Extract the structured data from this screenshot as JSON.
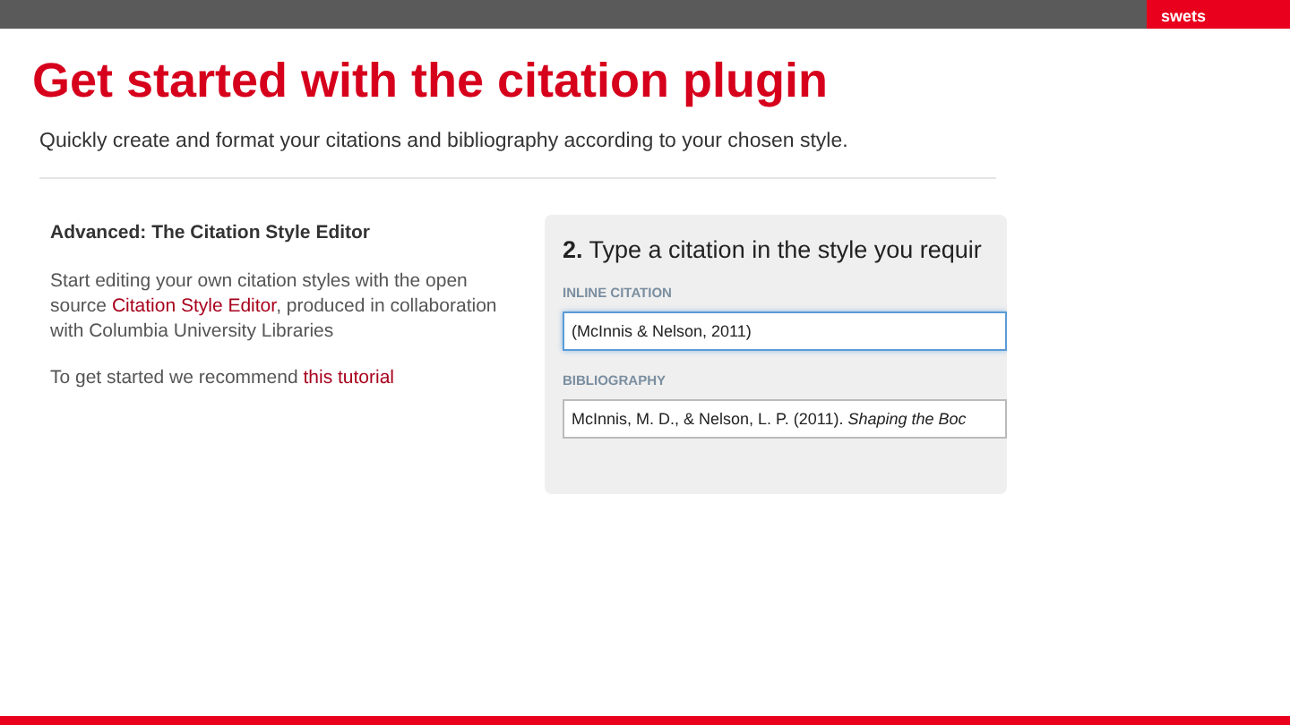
{
  "top_bar": {
    "brand": "swets"
  },
  "title": "Get started with the citation plugin",
  "subtitle": "Quickly create and format your citations and bibliography according to your chosen style.",
  "advanced": {
    "heading": "Advanced: The Citation Style Editor",
    "paragraphs": [
      {
        "before": "Start editing your own citation styles with the open source ",
        "link": "Citation Style Editor",
        "after": ", produced in collaboration with Columbia University Libraries"
      },
      {
        "before": "To get started we recommend ",
        "link": "this tutorial"
      }
    ]
  },
  "panel": {
    "heading": "**2.** Type a citation in the style you requir",
    "fields": [
      {
        "label": "INLINE CITATION",
        "value": "(McInnis & Nelson, 2011)",
        "focused": true
      },
      {
        "label": "BIBLIOGRAPHY",
        "value": "McInnis, M. D., & Nelson, L. P. (2011). *Shaping the Boc*",
        "focused": false
      }
    ]
  }
}
